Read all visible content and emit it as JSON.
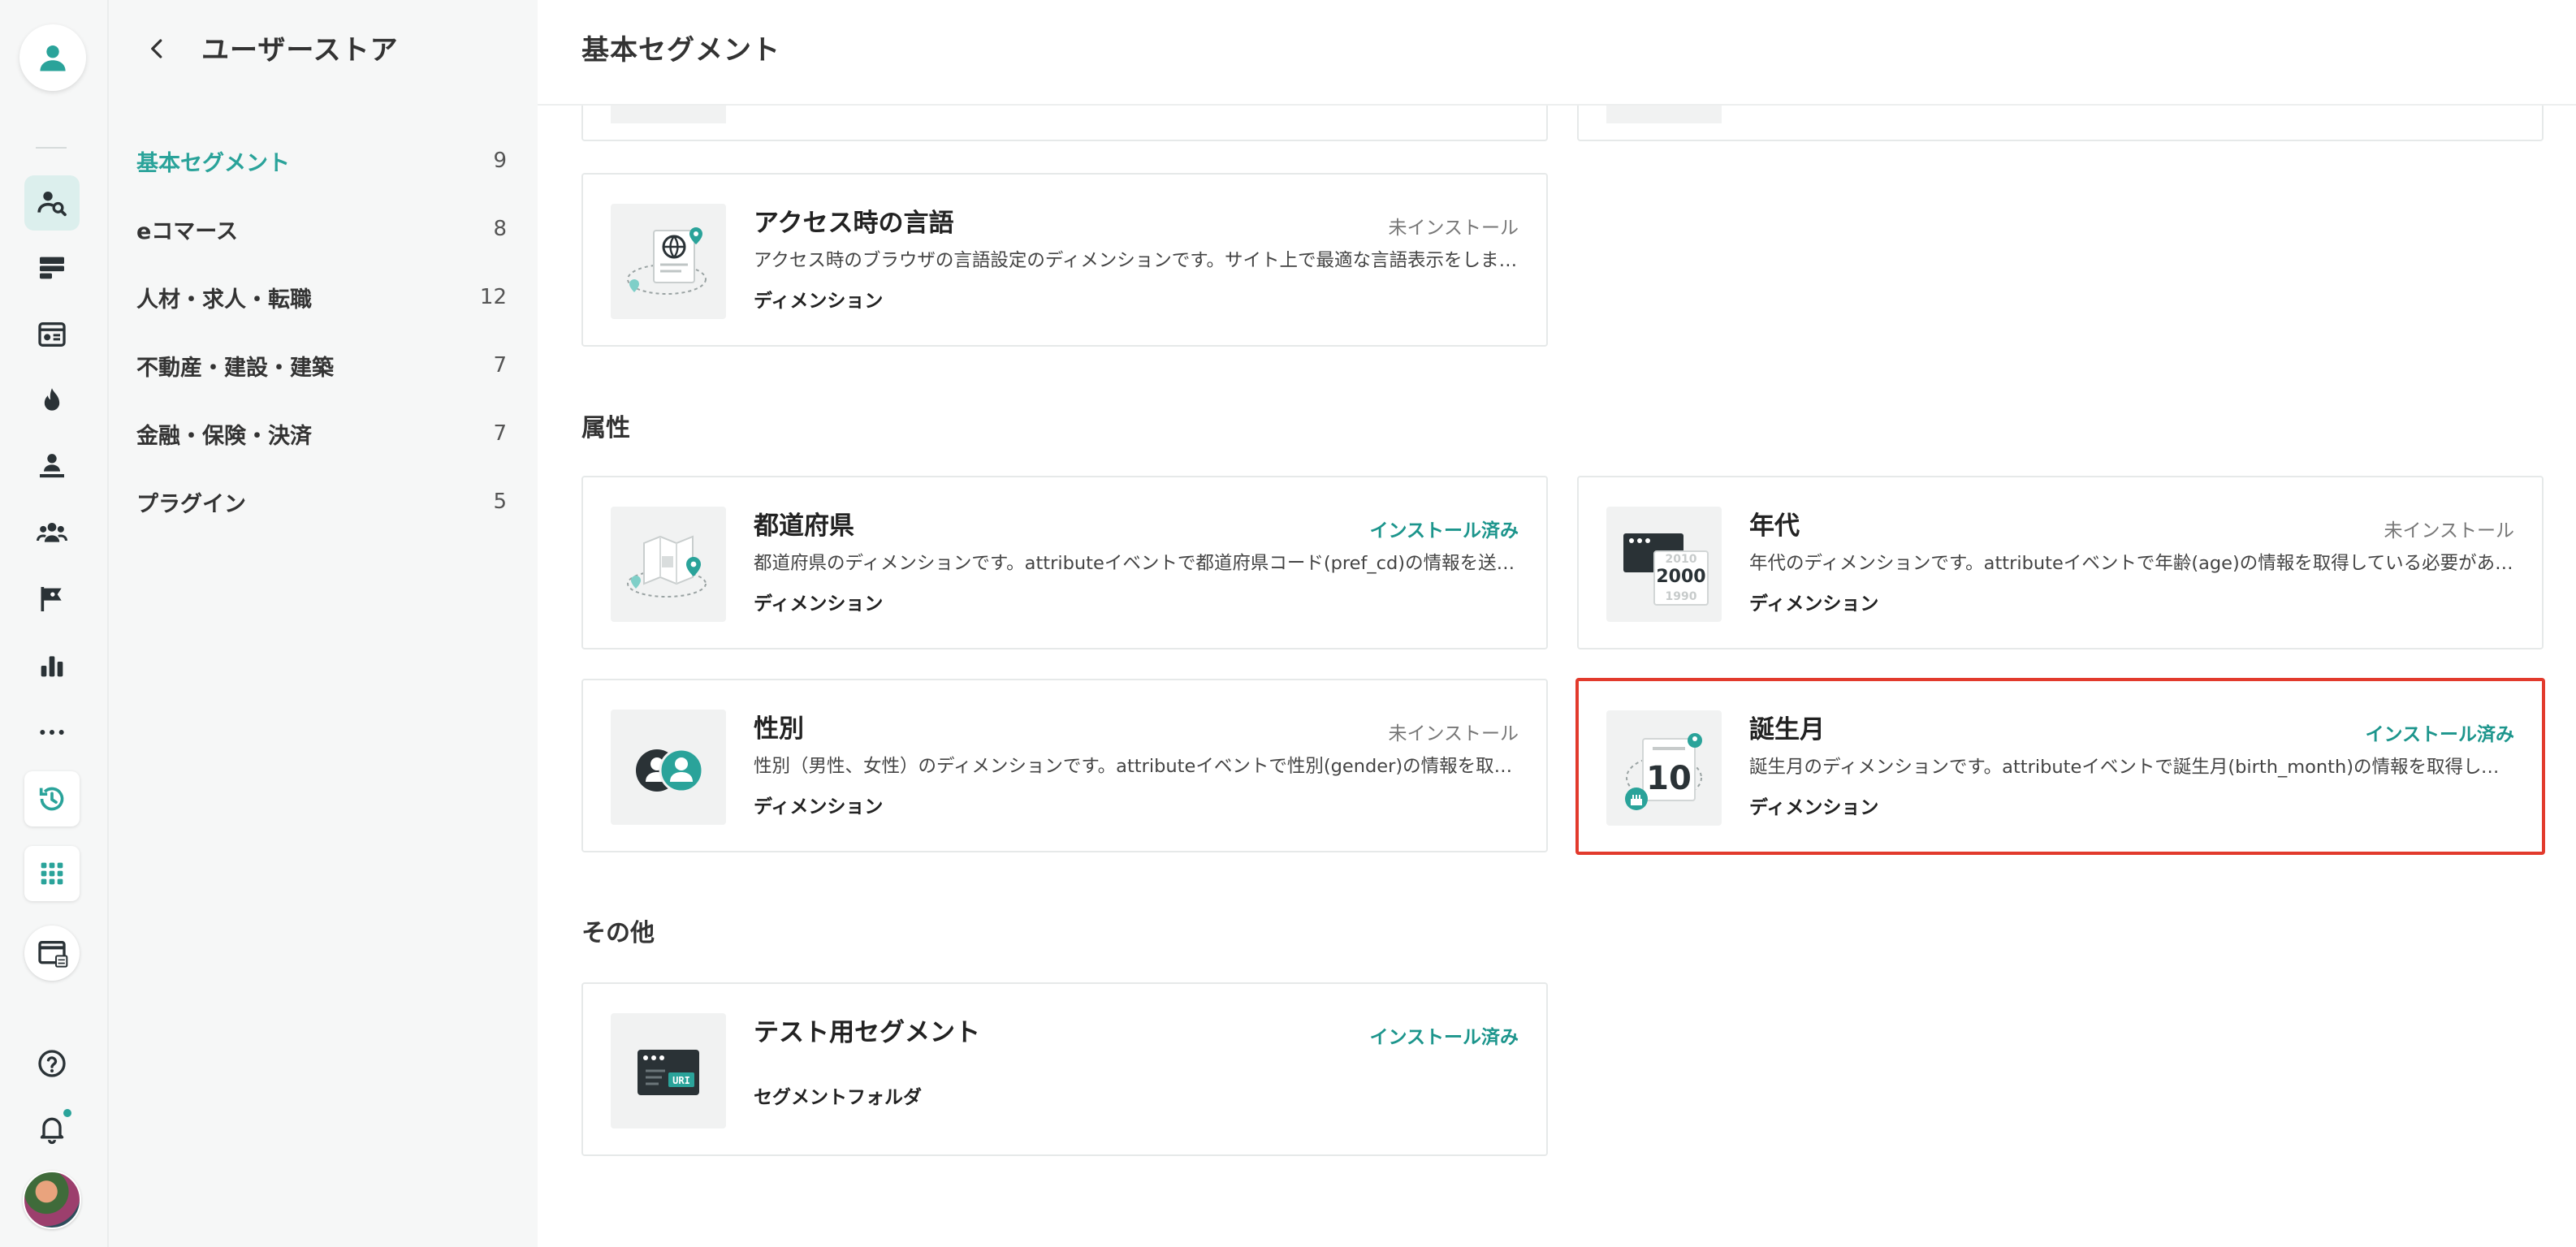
{
  "rail": {
    "icons": [
      "user-profile-icon",
      "user-search-icon",
      "storage-icon",
      "dashboard-icon",
      "fire-icon",
      "user-desk-icon",
      "group-icon",
      "flag-icon",
      "bar-chart-icon",
      "more-icon",
      "history-icon",
      "apps-grid-icon",
      "window-icon",
      "help-icon",
      "bell-icon"
    ]
  },
  "sidebar": {
    "title": "ユーザーストア",
    "items": [
      {
        "label": "基本セグメント",
        "count": "9"
      },
      {
        "label": "eコマース",
        "count": "8"
      },
      {
        "label": "人材・求人・転職",
        "count": "12"
      },
      {
        "label": "不動産・建設・建築",
        "count": "7"
      },
      {
        "label": "金融・保険・決済",
        "count": "7"
      },
      {
        "label": "プラグイン",
        "count": "5"
      }
    ]
  },
  "main": {
    "title": "基本セグメント",
    "sections": [
      {
        "title": "属性"
      },
      {
        "title": "その他"
      }
    ],
    "cards": [
      {
        "name": "アクセス時の言語",
        "status": "未インストール",
        "description": "アクセス時のブラウザの言語設定のディメンションです。サイト上で最適な言語表示をしましょう。",
        "kind": "ディメンション",
        "icon": "globe-document-icon"
      },
      {
        "name": "都道府県",
        "status": "インストール済み",
        "description": "都道府県のディメンションです。attributeイベントで都道府県コード(pref_cd)の情報を送る必要があります。",
        "kind": "ディメンション",
        "icon": "map-pin-icon"
      },
      {
        "name": "年代",
        "status": "未インストール",
        "description": "年代のディメンションです。attributeイベントで年齢(age)の情報を取得している必要があります。",
        "kind": "ディメンション",
        "icon": "year-calendar-icon"
      },
      {
        "name": "性別",
        "status": "未インストール",
        "description": "性別（男性、女性）のディメンションです。attributeイベントで性別(gender)の情報を取得している必要があります。",
        "kind": "ディメンション",
        "icon": "gender-people-icon"
      },
      {
        "name": "誕生月",
        "status": "インストール済み",
        "description": "誕生月のディメンションです。attributeイベントで誕生月(birth_month)の情報を取得している必要があります。",
        "kind": "ディメンション",
        "icon": "birthday-calendar-icon"
      },
      {
        "name": "テスト用セグメント",
        "status": "インストール済み",
        "description": "",
        "kind": "セグメントフォルダ",
        "icon": "uri-browser-icon"
      }
    ],
    "thumb_text": {
      "year_top": "2010",
      "year_main": "2000",
      "year_bottom": "1990",
      "day": "10",
      "uri": "URI"
    }
  },
  "colors": {
    "accent": "#2aa39a",
    "installed": "#1c958c",
    "highlight": "#e23a2c"
  }
}
